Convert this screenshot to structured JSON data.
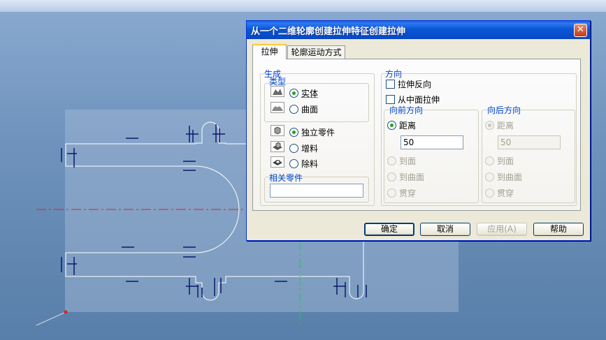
{
  "dialog": {
    "title": "从一个二维轮廓创建拉伸特征创建拉伸",
    "close_glyph": "✕",
    "tabs": [
      {
        "label": "拉伸",
        "active": true
      },
      {
        "label": "轮廓运动方式",
        "active": false
      }
    ],
    "generate": {
      "legend": "生成",
      "type_legend": "类型",
      "type_options": [
        {
          "label": "实体",
          "selected": true,
          "icon": "solid-icon"
        },
        {
          "label": "曲面",
          "selected": false,
          "icon": "surface-icon"
        }
      ],
      "part_options": [
        {
          "label": "独立零件",
          "selected": true,
          "icon": "new-part-icon"
        },
        {
          "label": "增料",
          "selected": false,
          "icon": "add-material-icon"
        },
        {
          "label": "除料",
          "selected": false,
          "icon": "remove-material-icon"
        }
      ],
      "related_legend": "相关零件",
      "related_value": ""
    },
    "direction": {
      "legend": "方向",
      "reverse_label": "拉伸反向",
      "reverse_checked": false,
      "midplane_label": "从中面拉伸",
      "midplane_checked": false,
      "forward": {
        "legend": "向前方向",
        "distance_label": "距离",
        "distance_value": "50",
        "to_face_label": "到面",
        "to_surface_label": "到曲面",
        "through_label": "贯穿",
        "selected": "distance",
        "enabled": true
      },
      "backward": {
        "legend": "向后方向",
        "distance_label": "距离",
        "distance_value": "50",
        "to_face_label": "到面",
        "to_surface_label": "到曲面",
        "through_label": "贯穿",
        "selected": "distance",
        "enabled": false
      }
    },
    "buttons": {
      "ok": "确定",
      "cancel": "取消",
      "apply": "应用(A)",
      "help": "帮助"
    }
  },
  "colors": {
    "viewport_bg": "#6f93bd",
    "sketch_line": "#ffffff",
    "centerline_red": "#e0201e",
    "centerline_green": "#1ecc4a",
    "dimension": "#0a1a6e",
    "title_bar": "#0a5ee3",
    "accent_legend": "#0046d5"
  }
}
